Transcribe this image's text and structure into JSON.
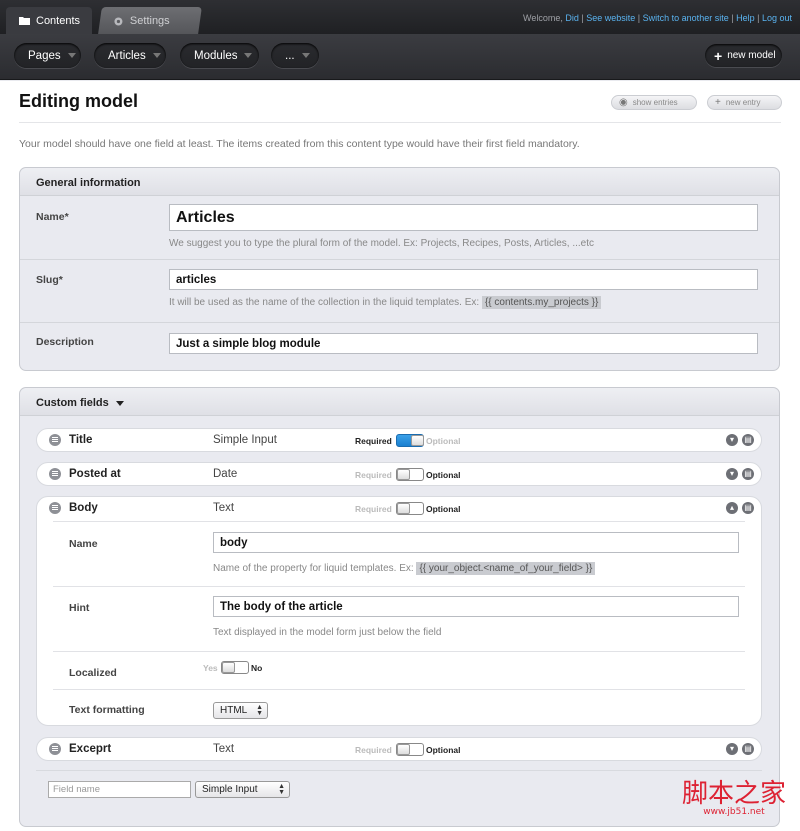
{
  "tabs": {
    "contents": "Contents",
    "settings": "Settings"
  },
  "toplinks": {
    "welcome": "Welcome,",
    "user": "Did",
    "see_website": "See website",
    "switch_site": "Switch to another site",
    "help": "Help",
    "logout": "Log out",
    "sep": "|"
  },
  "nav": {
    "pages": "Pages",
    "articles": "Articles",
    "modules": "Modules",
    "more": "...",
    "new_model": "new model",
    "new_model_icon": "+"
  },
  "page": {
    "title": "Editing model",
    "show_entries": "show entries",
    "new_entry": "new entry",
    "intro": "Your model should have one field at least. The items created from this content type would have their first field mandatory."
  },
  "general": {
    "heading": "General information",
    "name_label": "Name*",
    "name_value": "Articles",
    "name_hint": "We suggest you to type the plural form of the model. Ex: Projects, Recipes, Posts, Articles, ...etc",
    "slug_label": "Slug*",
    "slug_value": "articles",
    "slug_hint": "It will be used as the name of the collection in the liquid templates. Ex:",
    "slug_code": "{{ contents.my_projects }}",
    "desc_label": "Description",
    "desc_value": "Just a simple blog module"
  },
  "custom": {
    "heading": "Custom fields",
    "required": "Required",
    "optional": "Optional",
    "fields": [
      {
        "name": "Title",
        "type": "Simple Input",
        "required": true
      },
      {
        "name": "Posted at",
        "type": "Date",
        "required": false
      },
      {
        "name": "Body",
        "type": "Text",
        "required": false
      },
      {
        "name": "Exceprt",
        "type": "Text",
        "required": false
      }
    ],
    "body_detail": {
      "name_label": "Name",
      "name_value": "body",
      "name_hint": "Name of the property for liquid templates. Ex:",
      "name_code": "{{ your_object.<name_of_your_field> }}",
      "hint_label": "Hint",
      "hint_value": "The body of the article",
      "hint_hint": "Text displayed in the model form just below the field",
      "localized_label": "Localized",
      "yes": "Yes",
      "no": "No",
      "formatting_label": "Text formatting",
      "formatting_value": "HTML"
    },
    "new_field_placeholder": "Field name",
    "new_field_type": "Simple Input"
  },
  "watermark": {
    "cn": "脚本之家",
    "url": "www.jb51.net"
  }
}
